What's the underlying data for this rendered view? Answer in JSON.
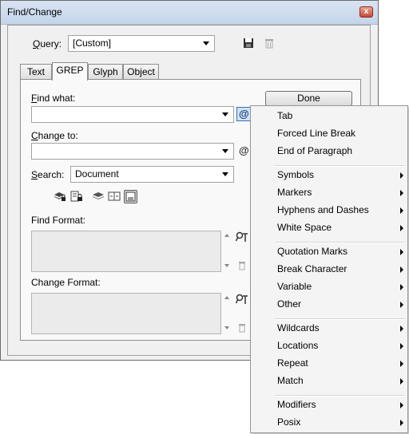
{
  "window": {
    "title": "Find/Change",
    "close_glyph": "x",
    "colors": {
      "titlebar": "#c4d5ea",
      "close": "#c74b36"
    }
  },
  "query": {
    "label": "Query:",
    "value": "[Custom]"
  },
  "tabs": [
    {
      "label": "Text",
      "active": false
    },
    {
      "label": "GREP",
      "active": true
    },
    {
      "label": "Glyph",
      "active": false
    },
    {
      "label": "Object",
      "active": false
    }
  ],
  "find_what": {
    "label": "Find what:",
    "value": ""
  },
  "change_to": {
    "label": "Change to:",
    "value": ""
  },
  "search": {
    "label": "Search:",
    "value": "Document"
  },
  "find_format": {
    "label": "Find Format:"
  },
  "change_format": {
    "label": "Change Format:"
  },
  "done_label": "Done",
  "special_char_glyph": "@",
  "icons": [
    "save-query-icon",
    "delete-query-icon",
    "special-characters-icon",
    "include-locked-layers-icon",
    "include-locked-stories-icon",
    "include-hidden-layers-icon",
    "include-master-pages-icon",
    "include-footnotes-icon",
    "specify-format-icon",
    "clear-format-icon"
  ],
  "menu": {
    "groups": [
      [
        {
          "label": "Tab",
          "submenu": false
        },
        {
          "label": "Forced Line Break",
          "submenu": false
        },
        {
          "label": "End of Paragraph",
          "submenu": false
        }
      ],
      [
        {
          "label": "Symbols",
          "submenu": true
        },
        {
          "label": "Markers",
          "submenu": true
        },
        {
          "label": "Hyphens and Dashes",
          "submenu": true
        },
        {
          "label": "White Space",
          "submenu": true
        }
      ],
      [
        {
          "label": "Quotation Marks",
          "submenu": true
        },
        {
          "label": "Break Character",
          "submenu": true
        },
        {
          "label": "Variable",
          "submenu": true
        },
        {
          "label": "Other",
          "submenu": true
        }
      ],
      [
        {
          "label": "Wildcards",
          "submenu": true
        },
        {
          "label": "Locations",
          "submenu": true
        },
        {
          "label": "Repeat",
          "submenu": true
        },
        {
          "label": "Match",
          "submenu": true
        }
      ],
      [
        {
          "label": "Modifiers",
          "submenu": true
        },
        {
          "label": "Posix",
          "submenu": true
        }
      ]
    ]
  }
}
